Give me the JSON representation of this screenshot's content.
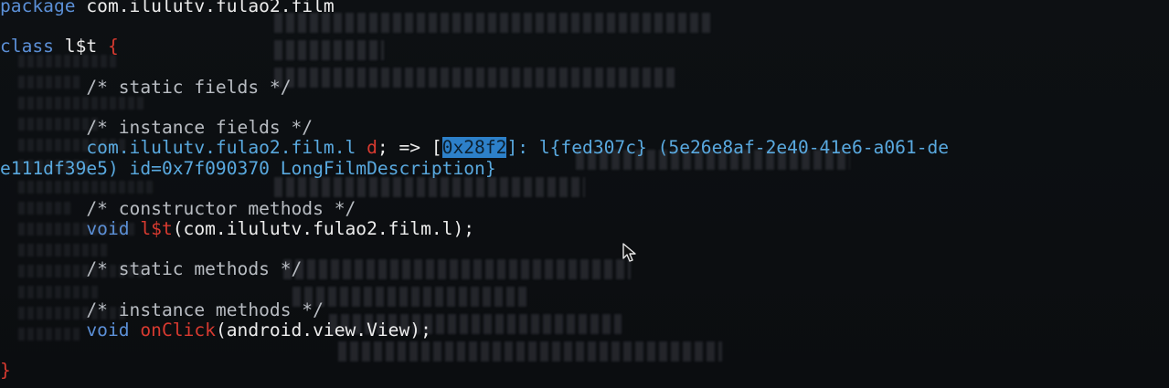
{
  "terminal": {
    "line1": {
      "keyword": "package",
      "name": " com.ilulutv.fulao2.film"
    },
    "line2": {
      "keyword": "class",
      "name": " l$t",
      "brace": " {"
    },
    "static_fields_comment": "/* static fields */",
    "instance_fields_comment": "/* instance fields */",
    "field": {
      "type": "com.ilulutv.fulao2.film.l",
      "name": " d",
      "arrow": "; => [",
      "address": "0x28f2",
      "desc": "]: l{fed307c} (5e26e8af-2e40-41e6-a061-de",
      "wrap": "e111df39e5) id=0x7f090370 LongFilmDescription}"
    },
    "constructor_comment": "/* constructor methods */",
    "constructor": {
      "keyword": "void",
      "name": " l$t",
      "args": "(com.ilulutv.fulao2.film.l);"
    },
    "static_methods_comment": "/* static methods */",
    "instance_methods_comment": "/* instance methods */",
    "method": {
      "keyword": "void",
      "name": " onClick",
      "args": "(android.view.View);"
    },
    "close_brace": "}"
  }
}
